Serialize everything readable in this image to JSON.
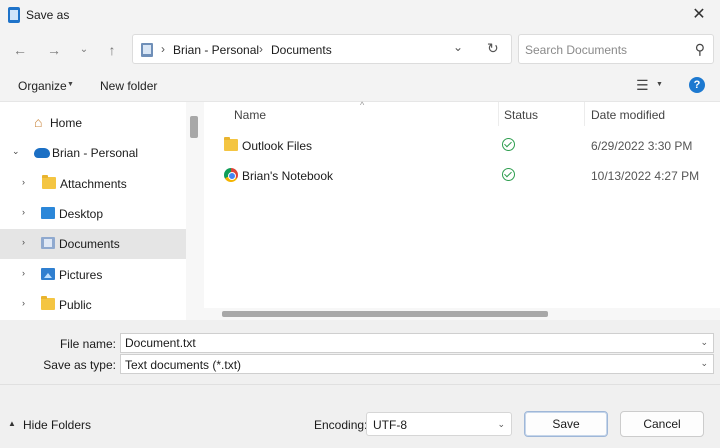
{
  "window": {
    "title": "Save as"
  },
  "navigation": {
    "breadcrumb": [
      "Brian - Personal",
      "Documents"
    ],
    "search_placeholder": "Search Documents"
  },
  "toolbar": {
    "organize_label": "Organize",
    "new_folder_label": "New folder"
  },
  "sidebar": {
    "items": [
      {
        "label": "Home",
        "icon": "home-icon"
      },
      {
        "label": "Brian - Personal",
        "icon": "onedrive-cloud-icon"
      },
      {
        "label": "Attachments",
        "icon": "folder-icon"
      },
      {
        "label": "Desktop",
        "icon": "desktop-icon"
      },
      {
        "label": "Documents",
        "icon": "documents-icon",
        "selected": true
      },
      {
        "label": "Pictures",
        "icon": "pictures-icon"
      },
      {
        "label": "Public",
        "icon": "folder-icon"
      }
    ]
  },
  "filelist": {
    "columns": [
      "Name",
      "Status",
      "Date modified"
    ],
    "rows": [
      {
        "name": "Outlook Files",
        "icon": "folder-icon",
        "status": "synced",
        "date": "6/29/2022 3:30 PM"
      },
      {
        "name": "Brian's Notebook",
        "icon": "chrome-icon",
        "status": "synced",
        "date": "10/13/2022 4:27 PM"
      }
    ]
  },
  "form": {
    "file_name_label": "File name:",
    "file_name_value": "Document.txt",
    "save_type_label": "Save as type:",
    "save_type_value": "Text documents (*.txt)"
  },
  "footer": {
    "hide_folders_label": "Hide Folders",
    "encoding_label": "Encoding:",
    "encoding_value": "UTF-8",
    "save_label": "Save",
    "cancel_label": "Cancel"
  },
  "colors": {
    "accent": "#1d79d0",
    "selected_bg": "#e5e5e5",
    "synced": "#2e9e4f",
    "folder": "#f4c542"
  }
}
